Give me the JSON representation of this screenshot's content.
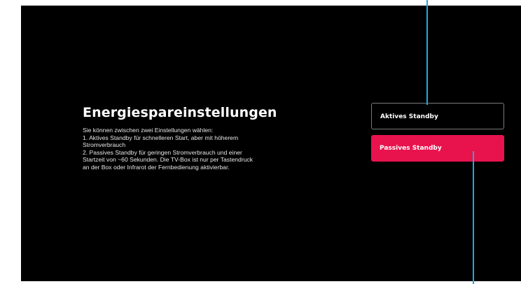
{
  "screen": {
    "title": "Energiespareinstellungen",
    "description_lines": [
      "Sie können zwischen zwei Einstellungen wählen:",
      "1. Aktives Standby für schnelleren Start, aber mit höherem",
      "Stromverbrauch",
      "2. Passives Standby für geringen Stromverbrauch und einer",
      "Startzeit von ~60 Sekunden. Die TV-Box ist nur per Tastendruck",
      "an der Box oder Infrarot der Fernbedienung aktivierbar."
    ]
  },
  "options": {
    "active_label": "Aktives Standby",
    "passive_label": "Passives Standby",
    "selected": "Passives Standby"
  },
  "colors": {
    "background": "#000000",
    "selected_option": "#e8134d",
    "annotation_line": "#1ba9dd"
  }
}
